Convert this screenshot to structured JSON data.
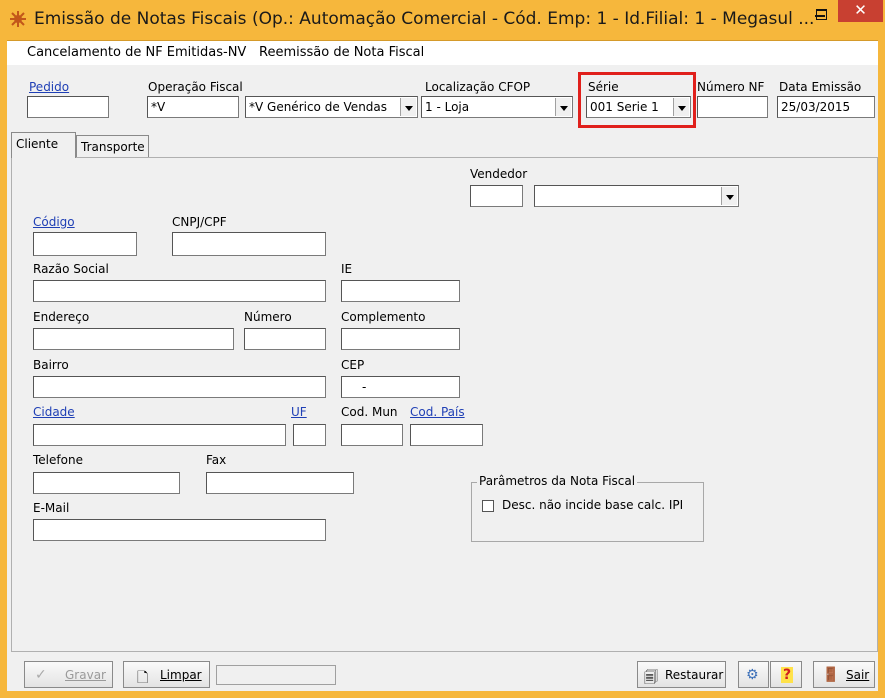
{
  "window": {
    "title": "Emissão de Notas Fiscais (Op.: Automação Comercial - Cód. Emp: 1 - Id.Filial: 1 - Megasul ...",
    "minimize_glyph": "–",
    "maximize_glyph": "□",
    "close_glyph": "✕"
  },
  "menu": {
    "items": [
      "Cancelamento de NF Emitidas-NV",
      "Reemissão de Nota Fiscal"
    ]
  },
  "header": {
    "pedido_label": "Pedido",
    "pedido_value": "",
    "operacao_label": "Operação Fiscal",
    "operacao_code": "*V",
    "operacao_desc": "*V Genérico de Vendas",
    "cfop_label": "Localização CFOP",
    "cfop_value": "1 - Loja",
    "serie_label": "Série",
    "serie_value": "001 Serie 1",
    "numero_label": "Número NF",
    "numero_value": "",
    "data_label": "Data Emissão",
    "data_value": "25/03/2015"
  },
  "tabs": [
    "Cliente",
    "Transporte"
  ],
  "cliente": {
    "vendedor_label": "Vendedor",
    "codigo_label": "Código",
    "cnpj_label": "CNPJ/CPF",
    "razao_label": "Razão Social",
    "ie_label": "IE",
    "endereco_label": "Endereço",
    "numero_label": "Número",
    "complemento_label": "Complemento",
    "bairro_label": "Bairro",
    "cep_label": "CEP",
    "cep_value": "-",
    "cidade_label": "Cidade",
    "uf_label": "UF",
    "codmun_label": "Cod. Mun",
    "codpais_label": "Cod. País",
    "telefone_label": "Telefone",
    "fax_label": "Fax",
    "email_label": "E-Mail"
  },
  "parametros": {
    "title": "Parâmetros da Nota Fiscal",
    "checkbox_label": "Desc. não incide base calc. IPI",
    "checked": false
  },
  "footer": {
    "gravar": "Gravar",
    "limpar": "Limpar",
    "restaurar": "Restaurar",
    "help_glyph": "?",
    "sair": "Sair"
  },
  "colors": {
    "titlebar": "#f6b73c",
    "link": "#1f3fb5",
    "highlight": "#e0201c",
    "close": "#c84031"
  }
}
